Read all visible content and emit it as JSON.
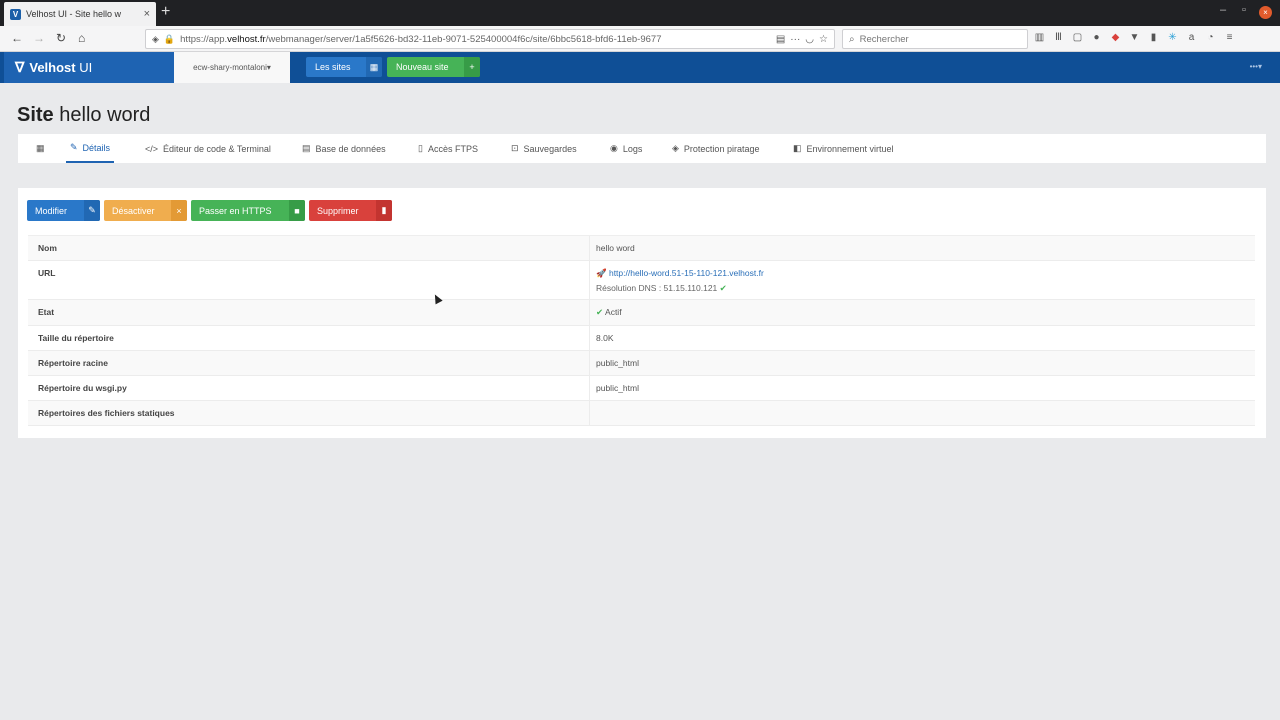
{
  "browser": {
    "tab_title": "Velhost UI - Site hello w",
    "tab_favicon": "V",
    "url_prefix": "https://app.",
    "url_host": "velhost.fr",
    "url_rest": "/webmanager/server/1a5f5626-bd32-11eb-9071-525400004f6c/site/6bbc5618-bfd6-11eb-9677",
    "search_placeholder": "Rechercher"
  },
  "app": {
    "brand_bold": "Velhost",
    "brand_light": "UI",
    "account": "ecw-shary-montaloni",
    "sites_button": "Les sites",
    "new_site_button": "Nouveau site"
  },
  "page": {
    "title_bold": "Site",
    "title_name": "hello word"
  },
  "tabs": [
    {
      "label": "Détails",
      "icon": "edit-icon"
    },
    {
      "label": "Éditeur de code & Terminal",
      "icon": "code-icon"
    },
    {
      "label": "Base de données",
      "icon": "database-icon"
    },
    {
      "label": "Accès FTPS",
      "icon": "file-icon"
    },
    {
      "label": "Sauvegardes",
      "icon": "backup-icon"
    },
    {
      "label": "Logs",
      "icon": "eye-icon"
    },
    {
      "label": "Protection piratage",
      "icon": "shield-icon"
    },
    {
      "label": "Environnement virtuel",
      "icon": "cube-icon"
    }
  ],
  "actions": {
    "modify": "Modifier",
    "deactivate": "Désactiver",
    "https": "Passer en HTTPS",
    "delete": "Supprimer"
  },
  "details": {
    "nom_label": "Nom",
    "nom_value": "hello word",
    "url_label": "URL",
    "url_value": "http://hello-word.51-15-110-121.velhost.fr",
    "dns_value": "Résolution DNS : 51.15.110.121",
    "etat_label": "Etat",
    "etat_value": "Actif",
    "taille_label": "Taille du répertoire",
    "taille_value": "8.0K",
    "racine_label": "Répertoire racine",
    "racine_value": "public_html",
    "wsgi_label": "Répertoire du wsgi.py",
    "wsgi_value": "public_html",
    "statiques_label": "Répertoires des fichiers statiques",
    "statiques_value": ""
  },
  "colors": {
    "header": "#0f4f96",
    "primary": "#2a78c9",
    "warning": "#f0ad4e",
    "success": "#46b357",
    "danger": "#d9413c"
  }
}
